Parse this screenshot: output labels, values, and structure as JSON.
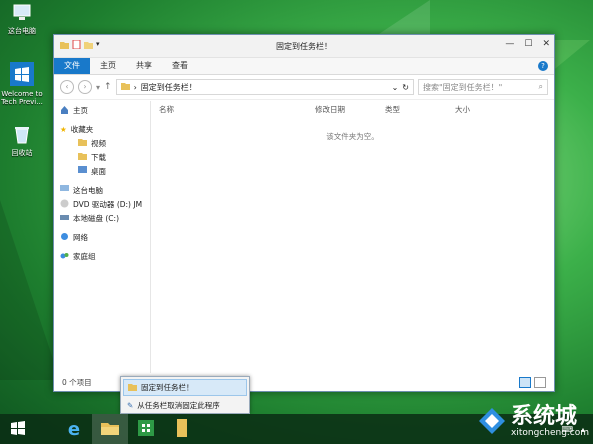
{
  "desktop": {
    "icons": [
      {
        "name": "this-pc",
        "label": "这台电脑"
      },
      {
        "name": "welcome",
        "label": "Welcome to Tech Previ..."
      },
      {
        "name": "recycle-bin",
        "label": "回收站"
      }
    ]
  },
  "window": {
    "title": "固定到任务栏！",
    "controls": {
      "minimize": "—",
      "maximize": "☐",
      "close": "✕"
    },
    "ribbon_tabs": [
      "文件",
      "主页",
      "共享",
      "查看"
    ],
    "help": "?",
    "address": {
      "separator": "›",
      "path": "固定到任务栏！",
      "refresh": "↻",
      "dropdown": "⌄"
    },
    "search": {
      "placeholder": "搜索\"固定到任务栏！\""
    },
    "nav": {
      "home": "主页",
      "favorites": "收藏夹",
      "fav_items": [
        "视频",
        "下载",
        "桌面"
      ],
      "this_pc": "这台电脑",
      "dvd": "DVD 驱动器 (D:) JM",
      "local_disk": "本地磁盘 (C:)",
      "network": "网络",
      "homegroup": "家庭组"
    },
    "columns": [
      "名称",
      "修改日期",
      "类型",
      "大小"
    ],
    "empty_message": "该文件夹为空。",
    "status": "0 个项目"
  },
  "jumplist": {
    "items": [
      "固定到任务栏！",
      "从任务栏取消固定此程序"
    ]
  },
  "watermark": {
    "cn": "系统城",
    "en": "xitongcheng.com"
  },
  "colors": {
    "accent": "#1979ca",
    "taskbar": "#0a2d14"
  }
}
